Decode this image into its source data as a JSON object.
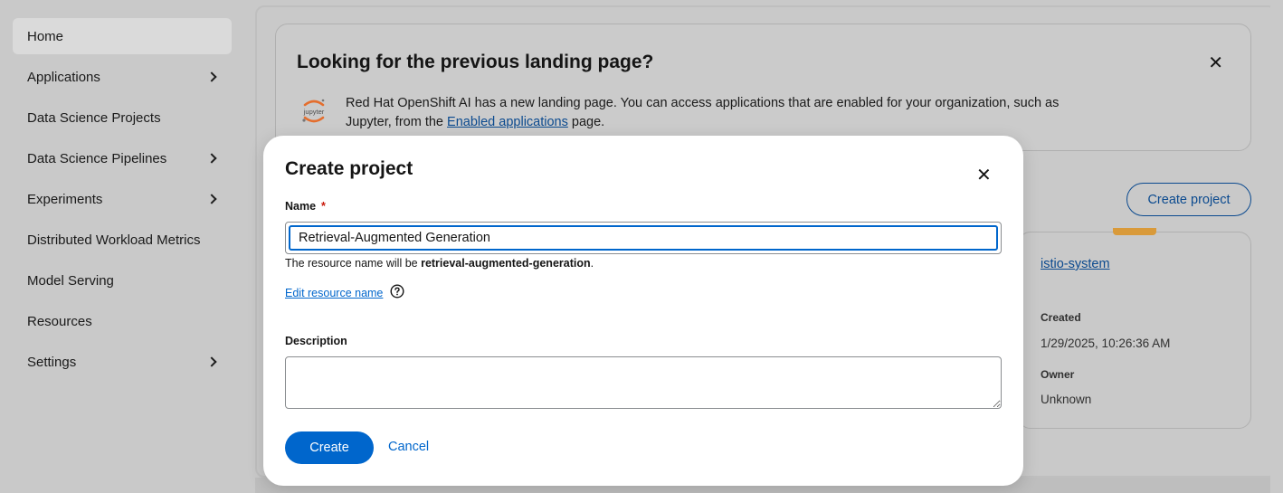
{
  "sidebar": {
    "items": [
      {
        "label": "Home",
        "active": true,
        "expandable": false
      },
      {
        "label": "Applications",
        "expandable": true
      },
      {
        "label": "Data Science Projects",
        "expandable": false
      },
      {
        "label": "Data Science Pipelines",
        "expandable": true
      },
      {
        "label": "Experiments",
        "expandable": true
      },
      {
        "label": "Distributed Workload Metrics",
        "expandable": false
      },
      {
        "label": "Model Serving",
        "expandable": false
      },
      {
        "label": "Resources",
        "expandable": false
      },
      {
        "label": "Settings",
        "expandable": true
      }
    ]
  },
  "banner": {
    "title": "Looking for the previous landing page?",
    "close_icon": "close-icon",
    "logo_text": "jupyter",
    "text_before": "Red Hat OpenShift AI has a new landing page. You can access applications that are enabled for your organization, such as Jupyter, from the ",
    "link_text": "Enabled applications",
    "text_after": " page."
  },
  "projects": {
    "create_button": "Create project",
    "card": {
      "name": "istio-system",
      "created_label": "Created",
      "created_value": "1/29/2025, 10:26:36 AM",
      "owner_label": "Owner",
      "owner_value": "Unknown"
    }
  },
  "modal": {
    "title": "Create project",
    "name_label": "Name",
    "required_mark": "*",
    "name_value": "Retrieval-Augmented Generation",
    "helper_prefix": "The resource name will be ",
    "resource_name": "retrieval-augmented-generation",
    "helper_suffix": ".",
    "edit_resource_link": "Edit resource name",
    "description_label": "Description",
    "description_value": "",
    "create_button": "Create",
    "cancel_button": "Cancel"
  },
  "colors": {
    "primary": "#0066cc",
    "link": "#0b4a8f",
    "required": "#c9190b",
    "card_accent": "#d99a3a"
  }
}
